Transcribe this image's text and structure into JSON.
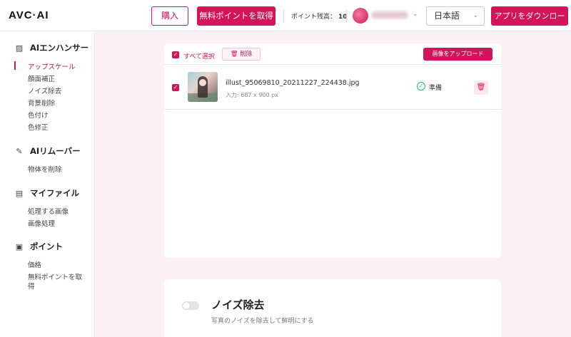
{
  "header": {
    "logo": "AVC·AI",
    "buy_label": "購入",
    "free_points_label": "無料ポイントを取得",
    "points_label": "ポイント残高：",
    "points_value": "10",
    "language": "日本語",
    "download_app_label": "アプリをダウンロード"
  },
  "sidebar": {
    "sections": [
      {
        "title": "AIエンハンサー",
        "icon": "image-icon",
        "items": [
          "アップスケール",
          "顔面補正",
          "ノイズ除去",
          "背景削除",
          "色付け",
          "色修正"
        ]
      },
      {
        "title": "AIリムーバー",
        "icon": "edit-icon",
        "items": [
          "物体を削除"
        ]
      },
      {
        "title": "マイファイル",
        "icon": "file-icon",
        "items": [
          "処理する画像",
          "画像処理"
        ]
      },
      {
        "title": "ポイント",
        "icon": "wallet-icon",
        "items": [
          "価格",
          "無料ポイントを取",
          "得"
        ]
      }
    ],
    "active_item": "アップスケール"
  },
  "toolbar": {
    "select_all_label": "すべて選択",
    "delete_label": "削除",
    "upload_label": "画像をアップロード"
  },
  "files": [
    {
      "name": "illust_95069810_20211227_224438.jpg",
      "size": "入力: 687 x 900 px",
      "status": "準備",
      "checked": true
    }
  ],
  "noise_card": {
    "title": "ノイズ除去",
    "description": "写真のノイズを除去して鮮明にする",
    "enabled": false
  },
  "colors": {
    "accent": "#d4145a",
    "background_main": "#fdf0f3",
    "ready": "#2bb673"
  }
}
